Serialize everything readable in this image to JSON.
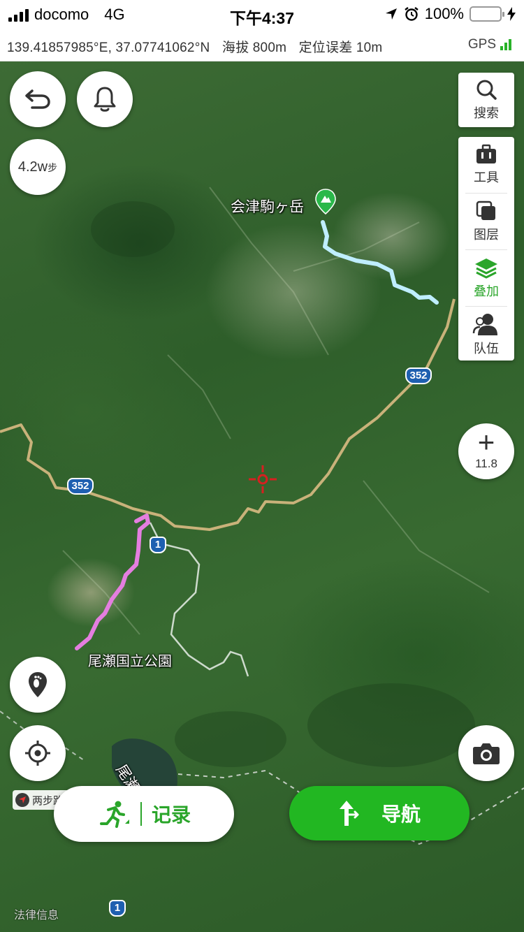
{
  "status_bar": {
    "carrier": "docomo",
    "network": "4G",
    "time": "下午4:37",
    "battery": "100%",
    "battery_level": 1.0
  },
  "info_bar": {
    "coordinates": "139.41857985°E, 37.07741062°N",
    "altitude": "海拔 800m",
    "accuracy": "定位误差 10m",
    "gps_label": "GPS"
  },
  "left_controls": {
    "steps": "4.2w",
    "steps_unit": "步",
    "mini_tag": "两步路"
  },
  "right_panel": {
    "search": "搜索",
    "tools": "工具",
    "layers": "图层",
    "overlay": "叠加",
    "team": "队伍"
  },
  "zoom": {
    "level": "11.8"
  },
  "map_labels": {
    "peak": "会津駒ヶ岳",
    "park": "尾瀬国立公園",
    "lake": "尾瀬沼",
    "route_352_a": "352",
    "route_352_b": "352",
    "route_1_a": "1",
    "route_1_b": "1",
    "legal": "法律信息"
  },
  "bottom": {
    "record": "记录",
    "navigate": "导航"
  },
  "colors": {
    "accent": "#22b722",
    "track_pink": "#e57ee0",
    "track_blue": "#bfeeff",
    "road": "#c9b27a",
    "route_shield": "#1e5fb0"
  }
}
